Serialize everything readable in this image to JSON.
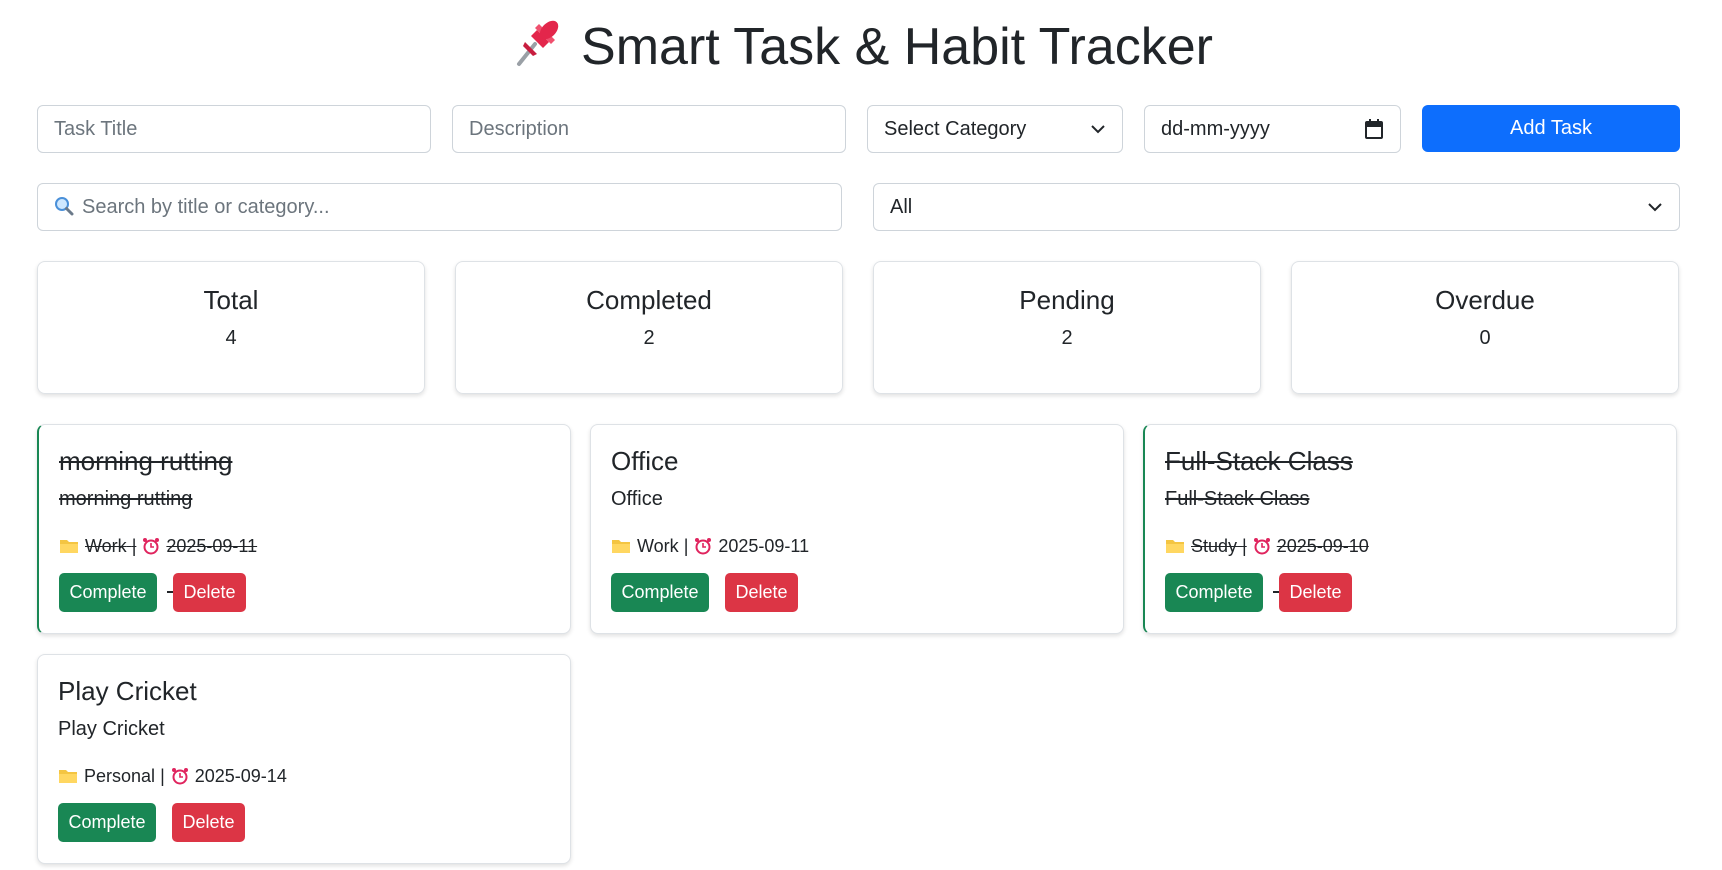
{
  "header": {
    "title": "Smart Task & Habit Tracker",
    "icon": "pushpin-icon"
  },
  "form": {
    "task_title_placeholder": "Task Title",
    "description_placeholder": "Description",
    "category_selected": "Select Category",
    "date_placeholder": "dd-mm-yyyy",
    "add_button": "Add Task"
  },
  "filters": {
    "search_placeholder": "Search by title or category...",
    "status_selected": "All"
  },
  "stats": [
    {
      "label": "Total",
      "value": "4"
    },
    {
      "label": "Completed",
      "value": "2"
    },
    {
      "label": "Pending",
      "value": "2"
    },
    {
      "label": "Overdue",
      "value": "0"
    }
  ],
  "tasks": [
    {
      "title": "morning rutting",
      "description": "morning rutting",
      "category": "Work",
      "separator": "|",
      "due": "2025-09-11",
      "completed": true,
      "complete_label": "Complete",
      "delete_label": "Delete"
    },
    {
      "title": "Office",
      "description": "Office",
      "category": "Work",
      "separator": "|",
      "due": "2025-09-11",
      "completed": false,
      "complete_label": "Complete",
      "delete_label": "Delete"
    },
    {
      "title": "Full-Stack Class",
      "description": "Full-Stack Class",
      "category": "Study",
      "separator": "|",
      "due": "2025-09-10",
      "completed": true,
      "complete_label": "Complete",
      "delete_label": "Delete"
    },
    {
      "title": "Play Cricket",
      "description": "Play Cricket",
      "category": "Personal",
      "separator": "|",
      "due": "2025-09-14",
      "completed": false,
      "complete_label": "Complete",
      "delete_label": "Delete"
    }
  ],
  "colors": {
    "primary": "#0d6efd",
    "success": "#198754",
    "danger": "#dc3545",
    "text": "#212529",
    "border": "#ced4da"
  }
}
